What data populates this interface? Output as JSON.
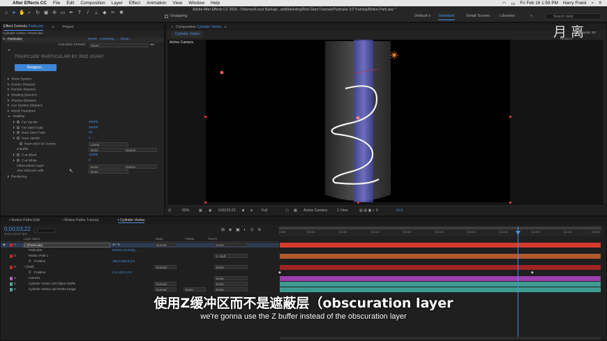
{
  "menubar": {
    "app": "After Effects CC",
    "items": [
      "File",
      "Edit",
      "Composition",
      "Layer",
      "Effect",
      "Animation",
      "View",
      "Window",
      "Help"
    ],
    "datetime": "Fri Feb 16  1:59 PM",
    "user": "Harry Frank"
  },
  "toolbar": {
    "snapping": "Snapping",
    "title": "Adobe After Effects CC 2018 - /Volumes/Local Backup/...ant/Marketing/Red Giant Tutorials/Particular 3.0 Training/Motion Path.aep *",
    "workspaces": [
      "Default",
      "Standard",
      "Small Screen",
      "Libraries"
    ],
    "active_workspace": "Standard",
    "search": "Search Help"
  },
  "effects": {
    "tab": "Effect Controls",
    "tab_layer": "Particular",
    "tab_project": "Project",
    "comp_path": "Cylinder Vortex • Particular",
    "fx_name": "Particular",
    "reset": "Reset",
    "licensing": "Licensing...",
    "about": "About...",
    "presets_label": "Animation Presets:",
    "presets_value": "None",
    "logo": "TRAPCODE PARTICULAR BY RED GIANT",
    "designer": "Designer...",
    "groups": [
      "Show System",
      "Emitter (Master)",
      "Particle (Master)",
      "Shading (Master)",
      "Physics (Master)",
      "Aux System (Master)",
      "World Transform"
    ],
    "visibility": "Visibility",
    "props": [
      {
        "label": "Far Vanish",
        "value": "20000"
      },
      {
        "label": "Far Start Fade",
        "value": "19000"
      },
      {
        "label": "Near Start Fade",
        "value": "10"
      },
      {
        "label": "Near Vanish",
        "value": "1"
      }
    ],
    "curves_label": "Near and Far Curves",
    "curves_value": "Linear",
    "zbuffer_label": "Z Buffer",
    "zbuffer_value": "None",
    "zbuffer_src": "Source",
    "zblack_label": "Z at Black",
    "zblack_value": "10000",
    "zwhite_label": "Z at White",
    "zwhite_value": "0",
    "obsc_label": "Obscuration Layer",
    "obsc_value": "None",
    "obsc_src": "Source",
    "also_label": "Also Obscure with",
    "also_value": "None",
    "rendering": "Rendering"
  },
  "composition": {
    "tab": "Composition",
    "comp": "Cylinder Vortex",
    "subtab": "Cylinder Vortex",
    "camera": "Active Camera",
    "renderer_label": "Renderer:",
    "renderer": "Classic 3D"
  },
  "viewer_bar": {
    "zoom": "50%",
    "time": "0;00;03;22",
    "res": "Full",
    "view": "Active Camera",
    "views": "1 View",
    "exposure": "+0.0"
  },
  "timeline": {
    "tabs": [
      "Motion Paths Edit",
      "Motion Paths Tutorial",
      "Cylinder Vortex"
    ],
    "time": "0;00;03;22",
    "frames": "00112 (29.97 fps)",
    "headers": {
      "name": "Layer Name",
      "mode": "Mode",
      "trkmat": "TrkMat",
      "parent": "Parent"
    },
    "layers": [
      {
        "num": "1",
        "name": "[Particular]",
        "mode": "Normal",
        "parent": "None",
        "color": "#c62828"
      },
      {
        "num": "",
        "name": "Particular",
        "sub": "Reset  Licensing...  ...",
        "color": ""
      },
      {
        "num": "2",
        "name": "Motion Path 1",
        "parent": "3. Null",
        "color": "#c62828"
      },
      {
        "num": "",
        "name": "Position",
        "value": "155.0,360.0,0.0",
        "color": ""
      },
      {
        "num": "3",
        "name": "[Null]",
        "mode": "Normal",
        "parent": "None",
        "color": "#c62828"
      },
      {
        "num": "",
        "name": "Position",
        "value": "0.0,-222.3,0.0",
        "color": ""
      },
      {
        "num": "4",
        "name": "Camera",
        "parent": "None",
        "color": "#b05ec4"
      },
      {
        "num": "5",
        "name": "Cylinder Vortex.c4d Object Buffer",
        "mode": "Normal",
        "parent": "None",
        "color": "#4fa69c"
      },
      {
        "num": "6",
        "name": "Cylinder Vortex.c4d RGBA Image",
        "mode": "Normal",
        "trkmat": "None",
        "parent": "None",
        "color": "#4fa69c"
      }
    ],
    "ruler": [
      "0:00f",
      "00:15f",
      "01:00f",
      "01:15f",
      "02:00f",
      "02:15f",
      "03:00f",
      "03:15f",
      "04:00f",
      "04:15f",
      "05:00f"
    ]
  },
  "subtitles": {
    "zh": "使用Z缓冲区而不是遮蔽层（obscuration layer",
    "en": "we're gonna use the Z buffer instead of the obscuration layer"
  }
}
